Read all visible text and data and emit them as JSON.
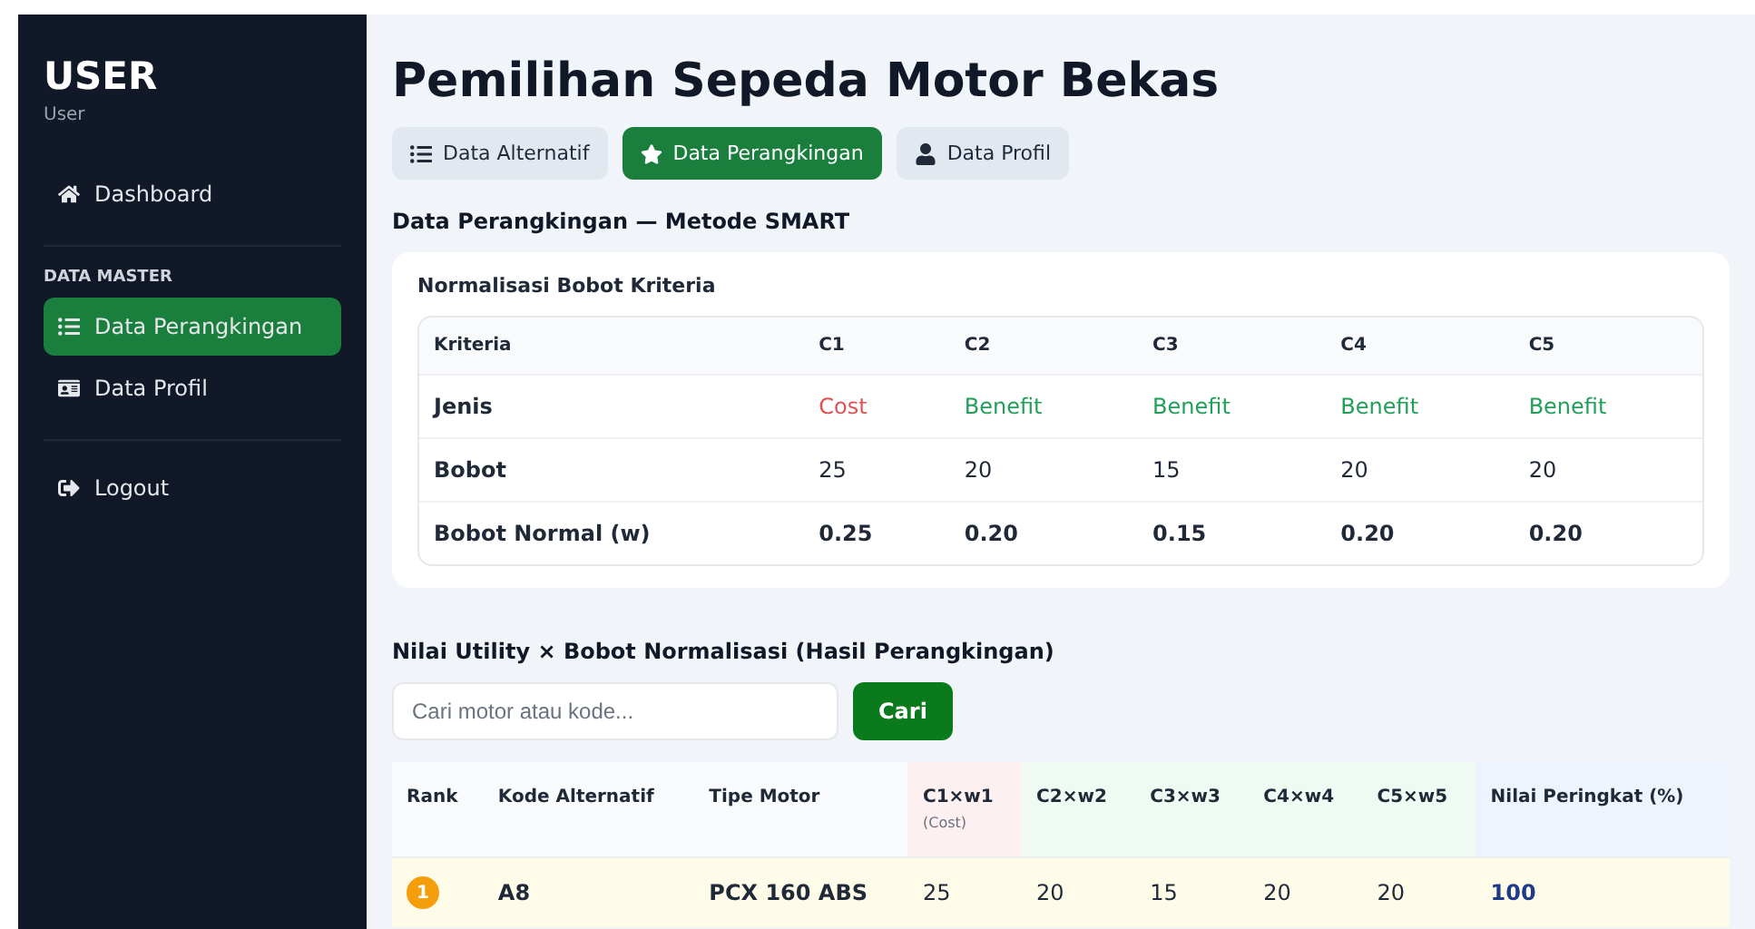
{
  "sidebar": {
    "title": "USER",
    "subtitle": "User",
    "items": [
      {
        "kind": "link",
        "label": "Dashboard",
        "selected": false
      },
      {
        "kind": "divider"
      },
      {
        "kind": "section",
        "label": "DATA MASTER"
      },
      {
        "kind": "link",
        "label": "Data Perangkingan",
        "selected": true
      },
      {
        "kind": "link",
        "label": "Data Profil",
        "selected": false
      },
      {
        "kind": "divider"
      },
      {
        "kind": "link",
        "label": "Logout",
        "selected": false
      }
    ]
  },
  "page_title": "Pemilihan Sepeda Motor Bekas",
  "tabs": [
    {
      "label": "Data Alternatif",
      "selected": false
    },
    {
      "label": "Data Perangkingan",
      "selected": true
    },
    {
      "label": "Data Profil",
      "selected": false
    }
  ],
  "section_title": "Data Perangkingan — Metode SMART",
  "criteria_card": {
    "title": "Normalisasi Bobot Kriteria",
    "columns": [
      "Kriteria",
      "C1",
      "C2",
      "C3",
      "C4",
      "C5"
    ],
    "rows": [
      {
        "kind": "type",
        "cells": [
          {
            "text": "Jenis",
            "kind": "label"
          },
          {
            "text": "Cost",
            "kind": "cost"
          },
          {
            "text": "Benefit",
            "kind": "benefit"
          },
          {
            "text": "Benefit",
            "kind": "benefit"
          },
          {
            "text": "Benefit",
            "kind": "benefit"
          },
          {
            "text": "Benefit",
            "kind": "benefit"
          }
        ]
      },
      {
        "kind": "plain",
        "cells": [
          {
            "text": "Bobot",
            "kind": "label"
          },
          {
            "text": "25"
          },
          {
            "text": "20"
          },
          {
            "text": "15"
          },
          {
            "text": "20"
          },
          {
            "text": "20"
          }
        ]
      },
      {
        "kind": "bold",
        "cells": [
          {
            "text": "Bobot Normal (w)",
            "kind": "label"
          },
          {
            "text": "0.25"
          },
          {
            "text": "0.20"
          },
          {
            "text": "0.15"
          },
          {
            "text": "0.20"
          },
          {
            "text": "0.20"
          }
        ]
      }
    ]
  },
  "ranking": {
    "title": "Nilai Utility × Bobot Normalisasi (Hasil Perangkingan)",
    "search": {
      "placeholder": "Cari motor atau kode...",
      "button": "Cari"
    },
    "columns": [
      {
        "label": "Rank",
        "kind": "plain"
      },
      {
        "label": "Kode Alternatif",
        "kind": "plain"
      },
      {
        "label": "Tipe Motor",
        "kind": "plain"
      },
      {
        "label": "C1×w1",
        "note": "(Cost)",
        "kind": "cost"
      },
      {
        "label": "C2×w2",
        "kind": "benefit"
      },
      {
        "label": "C3×w3",
        "kind": "benefit"
      },
      {
        "label": "C4×w4",
        "kind": "benefit"
      },
      {
        "label": "C5×w5",
        "kind": "benefit"
      },
      {
        "label": "Nilai Peringkat (%)",
        "kind": "score"
      }
    ],
    "rows": [
      {
        "rank": "1",
        "code": "A8",
        "type": "PCX 160 ABS",
        "values": [
          "25",
          "20",
          "15",
          "20",
          "20"
        ],
        "score": "100",
        "top": true
      }
    ]
  }
}
